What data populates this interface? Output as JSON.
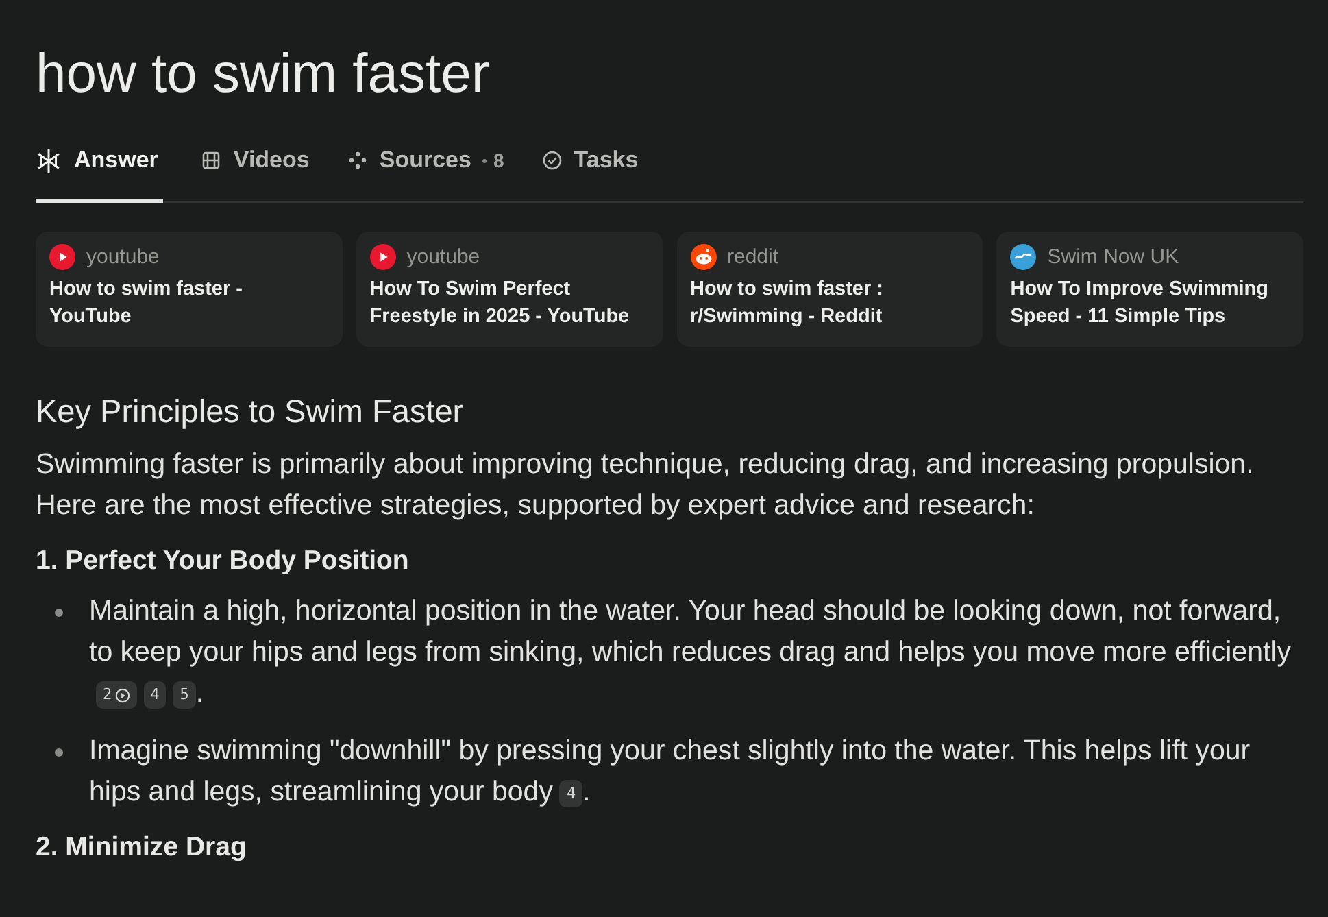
{
  "query": "how to swim faster",
  "tabs": [
    {
      "label": "Answer",
      "selected": true
    },
    {
      "label": "Videos",
      "selected": false
    },
    {
      "label": "Sources",
      "count": "8",
      "selected": false
    },
    {
      "label": "Tasks",
      "selected": false
    }
  ],
  "sources": [
    {
      "site": "youtube",
      "title": "How to swim faster - YouTube"
    },
    {
      "site": "youtube",
      "title": "How To Swim Perfect Freestyle in 2025 - YouTube"
    },
    {
      "site": "reddit",
      "title": "How to swim faster : r/Swimming - Reddit"
    },
    {
      "site": "Swim Now UK",
      "title": "How To Improve Swimming Speed - 11 Simple Tips"
    }
  ],
  "heading": "Key Principles to Swim Faster",
  "intro": "Swimming faster is primarily about improving technique, reducing drag, and increasing propulsion. Here are the most effective strategies, supported by expert advice and research:",
  "sections": [
    {
      "title": "1. Perfect Your Body Position",
      "bullets": [
        {
          "text": "Maintain a high, horizontal position in the water. Your head should be looking down, not forward, to keep your hips and legs from sinking, which reduces drag and helps you move more efficiently",
          "citations": [
            {
              "label": "2",
              "video": true
            },
            {
              "label": "4",
              "video": false
            },
            {
              "label": "5",
              "video": false
            }
          ],
          "end": "."
        },
        {
          "text": "Imagine swimming \"downhill\" by pressing your chest slightly into the water. This helps lift your hips and legs, streamlining your body",
          "citations": [
            {
              "label": "4",
              "video": false
            }
          ],
          "end": "."
        }
      ]
    },
    {
      "title": "2. Minimize Drag"
    }
  ]
}
